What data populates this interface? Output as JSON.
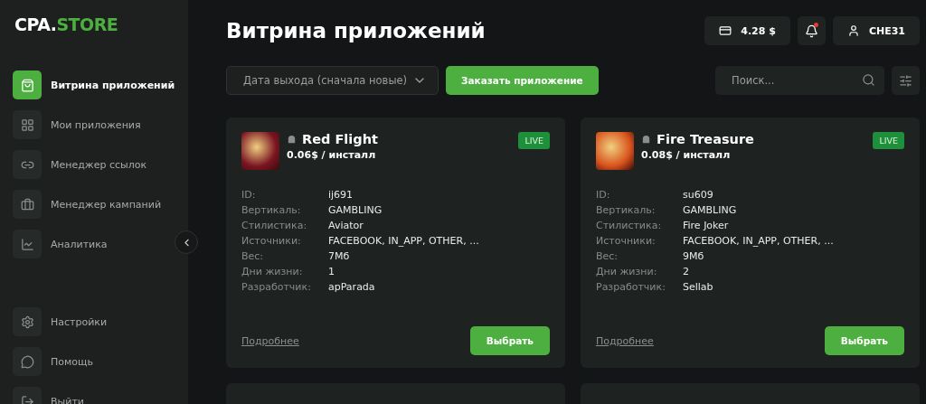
{
  "logo": {
    "brand": "CPA.",
    "accent": "STORE"
  },
  "nav": [
    {
      "label": "Витрина приложений",
      "selected": true
    },
    {
      "label": "Мои приложения",
      "selected": false
    },
    {
      "label": "Менеджер ссылок",
      "selected": false
    },
    {
      "label": "Менеджер кампаний",
      "selected": false
    },
    {
      "label": "Аналитика",
      "selected": false
    }
  ],
  "nav_bottom": [
    {
      "label": "Настройки"
    },
    {
      "label": "Помощь"
    },
    {
      "label": "Выйти"
    }
  ],
  "page_title": "Витрина приложений",
  "header": {
    "balance": "4.28 $",
    "notifications_unread": true,
    "user": "CHE31"
  },
  "toolbar": {
    "sort": "Дата выхода (сначала новые)",
    "order_button": "Заказать приложение",
    "search_placeholder": "Поиск..."
  },
  "apps": [
    {
      "name": "Red Flight",
      "price": "0.06$ / инсталл",
      "status": "LIVE",
      "fields": [
        {
          "label": "ID:",
          "value": "ij691"
        },
        {
          "label": "Вертикаль:",
          "value": "GAMBLING"
        },
        {
          "label": "Стилистика:",
          "value": "Aviator"
        },
        {
          "label": "Источники:",
          "value": "FACEBOOK, IN_APP, OTHER, ..."
        },
        {
          "label": "Вес:",
          "value": "7Мб"
        },
        {
          "label": "Дни жизни:",
          "value": "1"
        },
        {
          "label": "Разработчик:",
          "value": "apParada"
        }
      ],
      "more": "Подробнее",
      "select": "Выбрать"
    },
    {
      "name": "Fire Treasure",
      "price": "0.08$ / инсталл",
      "status": "LIVE",
      "fields": [
        {
          "label": "ID:",
          "value": "su609"
        },
        {
          "label": "Вертикаль:",
          "value": "GAMBLING"
        },
        {
          "label": "Стилистика:",
          "value": "Fire Joker"
        },
        {
          "label": "Источники:",
          "value": "FACEBOOK, IN_APP, OTHER, ..."
        },
        {
          "label": "Вес:",
          "value": "9Мб"
        },
        {
          "label": "Дни жизни:",
          "value": "2"
        },
        {
          "label": "Разработчик:",
          "value": "Sellab"
        }
      ],
      "more": "Подробнее",
      "select": "Выбрать"
    }
  ]
}
